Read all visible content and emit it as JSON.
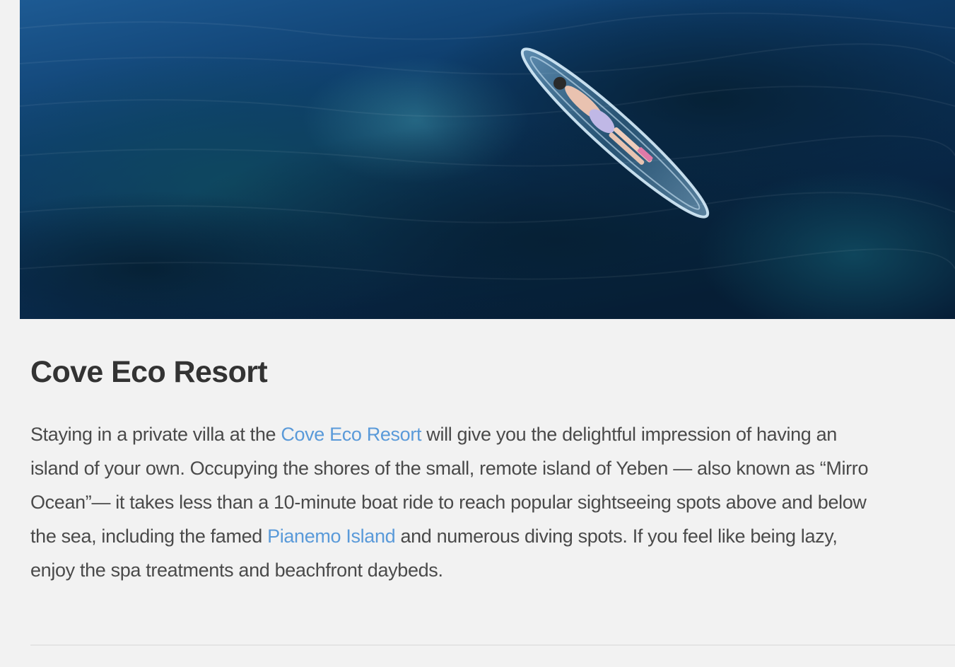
{
  "hero_image": {
    "subject": "aerial-photo-woman-lying-in-clear-kayak-on-ocean"
  },
  "article": {
    "title": "Cove Eco Resort",
    "lines": [
      {
        "t1": "Staying in a private villa at the ",
        "link": "Cove Eco Resort",
        "t2": " will give you the delightful impression of having an"
      },
      {
        "t1": "island of your own. Occupying the shores of the small, remote island of Yeben — also known as “Mirro"
      },
      {
        "t1": "Ocean”— it takes less than a 10-minute boat ride to reach popular sightseeing spots above and below"
      },
      {
        "t1": "the sea, including the famed ",
        "link": "Pianemo Island",
        "t2": " and numerous diving spots. If you feel like being lazy,"
      },
      {
        "t1": "enjoy the spa treatments and beachfront daybeds."
      }
    ]
  },
  "colors": {
    "page_background": "#f2f2f2",
    "title": "#333333",
    "body_text": "#4a4a4a",
    "link": "#5a9ad9",
    "divider": "#e4e4e4"
  }
}
